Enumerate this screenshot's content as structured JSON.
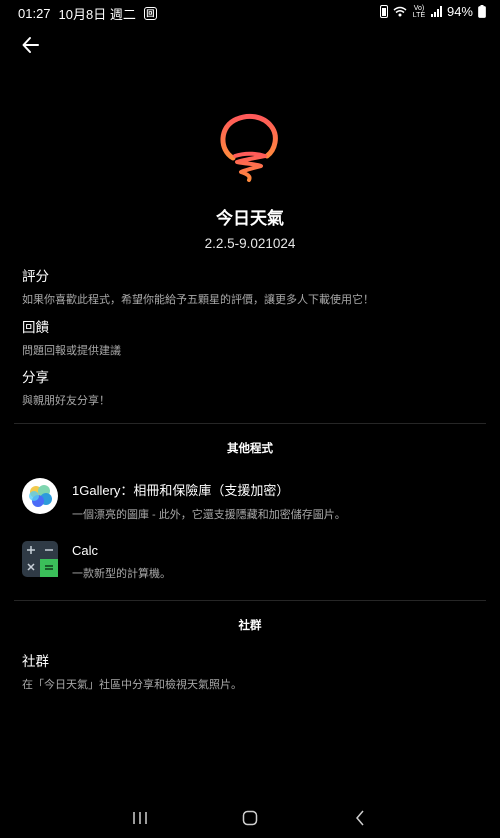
{
  "status_bar": {
    "time": "01:27",
    "date": "10月8日 週二",
    "notification_icon": "app-notification",
    "volte": "Vo) LTE",
    "battery": "94%"
  },
  "header": {
    "back_icon": "back-arrow"
  },
  "app": {
    "name": "今日天氣",
    "version": "2.2.5-9.021024",
    "logo_color_top": "#ff5a5a",
    "logo_color_bottom": "#ff8a3d"
  },
  "items": [
    {
      "title": "評分",
      "subtitle": "如果你喜歡此程式，希望你能給予五顆星的評價，讓更多人下載使用它！"
    },
    {
      "title": "回饋",
      "subtitle": "問題回報或提供建議"
    },
    {
      "title": "分享",
      "subtitle": "與親朋好友分享！"
    }
  ],
  "other_apps": {
    "section_title": "其他程式",
    "apps": [
      {
        "name": "1Gallery：相冊和保險庫（支援加密）",
        "description": "一個漂亮的圖庫 - 此外，它還支援隱藏和加密儲存圖片。"
      },
      {
        "name": "Calc",
        "description": "一款新型的計算機。"
      }
    ]
  },
  "community": {
    "section_title": "社群",
    "title": "社群",
    "subtitle": "在「今日天氣」社區中分享和檢視天氣照片。"
  },
  "colors": {
    "background": "#000000",
    "secondary_text": "#a8a8a8",
    "calc_green": "#3bbf5a"
  }
}
